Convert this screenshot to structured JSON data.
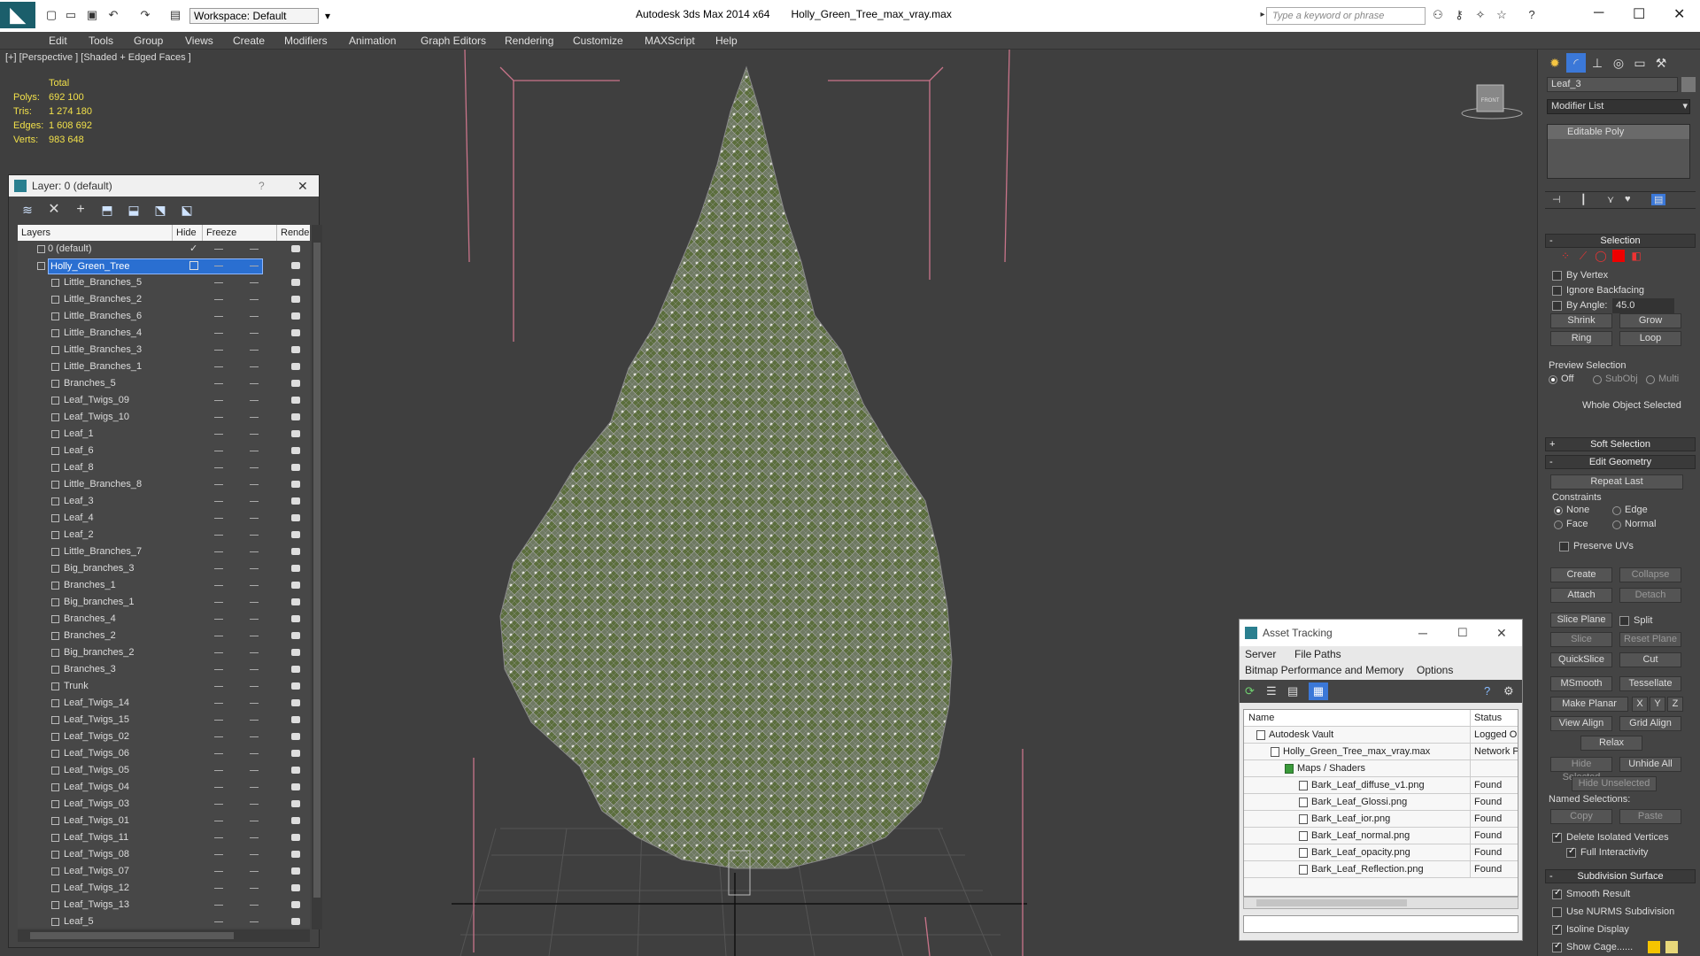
{
  "titlebar": {
    "workspace": "Workspace: Default",
    "app": "Autodesk 3ds Max  2014 x64",
    "file": "Holly_Green_Tree_max_vray.max",
    "search_placeholder": "Type a keyword or phrase"
  },
  "menu": [
    "Edit",
    "Tools",
    "Group",
    "Views",
    "Create",
    "Modifiers",
    "Animation",
    "Graph Editors",
    "Rendering",
    "Customize",
    "MAXScript",
    "Help"
  ],
  "viewport": {
    "label": "[+] [Perspective ] [Shaded + Edged Faces ]",
    "viewcube": "FRONT",
    "stats": {
      "header": "Total",
      "rows": [
        {
          "k": "Polys:",
          "v": "692 100"
        },
        {
          "k": "Tris:",
          "v": "1 274 180"
        },
        {
          "k": "Edges:",
          "v": "1 608 692"
        },
        {
          "k": "Verts:",
          "v": "983 648"
        }
      ]
    }
  },
  "layer_window": {
    "title": "Layer: 0 (default)",
    "help": "?",
    "cols": {
      "layers": "Layers",
      "hide": "Hide",
      "freeze": "Freeze",
      "render": "Rende"
    },
    "rows": [
      "0 (default)",
      "Holly_Green_Tree",
      "Little_Branches_5",
      "Little_Branches_2",
      "Little_Branches_6",
      "Little_Branches_4",
      "Little_Branches_3",
      "Little_Branches_1",
      "Branches_5",
      "Leaf_Twigs_09",
      "Leaf_Twigs_10",
      "Leaf_1",
      "Leaf_6",
      "Leaf_8",
      "Little_Branches_8",
      "Leaf_3",
      "Leaf_4",
      "Leaf_2",
      "Little_Branches_7",
      "Big_branches_3",
      "Branches_1",
      "Big_branches_1",
      "Branches_4",
      "Branches_2",
      "Big_branches_2",
      "Branches_3",
      "Trunk",
      "Leaf_Twigs_14",
      "Leaf_Twigs_15",
      "Leaf_Twigs_02",
      "Leaf_Twigs_06",
      "Leaf_Twigs_05",
      "Leaf_Twigs_04",
      "Leaf_Twigs_03",
      "Leaf_Twigs_01",
      "Leaf_Twigs_11",
      "Leaf_Twigs_08",
      "Leaf_Twigs_07",
      "Leaf_Twigs_12",
      "Leaf_Twigs_13",
      "Leaf_5"
    ]
  },
  "asset_tracking": {
    "title": "Asset Tracking",
    "menu1": [
      "Server",
      "File",
      "Paths"
    ],
    "menu2": [
      "Bitmap Performance and Memory",
      "Options"
    ],
    "cols": {
      "name": "Name",
      "status": "Status"
    },
    "rows": [
      {
        "name": "Autodesk Vault",
        "status": "Logged Ou",
        "indent": 0
      },
      {
        "name": "Holly_Green_Tree_max_vray.max",
        "status": "Network P",
        "indent": 1
      },
      {
        "name": "Maps / Shaders",
        "status": "",
        "indent": 2
      },
      {
        "name": "Bark_Leaf_diffuse_v1.png",
        "status": "Found",
        "indent": 3
      },
      {
        "name": "Bark_Leaf_Glossi.png",
        "status": "Found",
        "indent": 3
      },
      {
        "name": "Bark_Leaf_ior.png",
        "status": "Found",
        "indent": 3
      },
      {
        "name": "Bark_Leaf_normal.png",
        "status": "Found",
        "indent": 3
      },
      {
        "name": "Bark_Leaf_opacity.png",
        "status": "Found",
        "indent": 3
      },
      {
        "name": "Bark_Leaf_Reflection.png",
        "status": "Found",
        "indent": 3
      }
    ]
  },
  "command_panel": {
    "object_name": "Leaf_3",
    "modifier_list": "Modifier List",
    "stack_item": "Editable Poly",
    "selection": {
      "title": "Selection",
      "by_vertex": "By Vertex",
      "ignore_backfacing": "Ignore Backfacing",
      "by_angle": "By Angle:",
      "angle": "45.0",
      "shrink": "Shrink",
      "grow": "Grow",
      "ring": "Ring",
      "loop": "Loop",
      "preview": "Preview Selection",
      "off": "Off",
      "subobj": "SubObj",
      "multi": "Multi",
      "status": "Whole Object Selected"
    },
    "soft_selection": "Soft Selection",
    "edit_geometry": {
      "title": "Edit Geometry",
      "repeat_last": "Repeat Last",
      "constraints": "Constraints",
      "none": "None",
      "edge": "Edge",
      "face": "Face",
      "normal": "Normal",
      "preserve_uvs": "Preserve UVs",
      "create": "Create",
      "collapse": "Collapse",
      "attach": "Attach",
      "detach": "Detach",
      "slice_plane": "Slice Plane",
      "split": "Split",
      "slice": "Slice",
      "reset_plane": "Reset Plane",
      "quickslice": "QuickSlice",
      "cut": "Cut",
      "msmooth": "MSmooth",
      "tessellate": "Tessellate",
      "make_planar": "Make Planar",
      "x": "X",
      "y": "Y",
      "z": "Z",
      "view_align": "View Align",
      "grid_align": "Grid Align",
      "relax": "Relax",
      "hide_selected": "Hide Selected",
      "unhide_all": "Unhide All",
      "hide_unselected": "Hide Unselected",
      "named_selections": "Named Selections:",
      "copy": "Copy",
      "paste": "Paste",
      "delete_isolated": "Delete Isolated Vertices",
      "full_interactivity": "Full Interactivity"
    },
    "subdivision": {
      "title": "Subdivision Surface",
      "smooth_result": "Smooth Result",
      "use_nurms": "Use NURMS Subdivision",
      "isoline": "Isoline Display",
      "show_cage": "Show Cage......"
    }
  }
}
